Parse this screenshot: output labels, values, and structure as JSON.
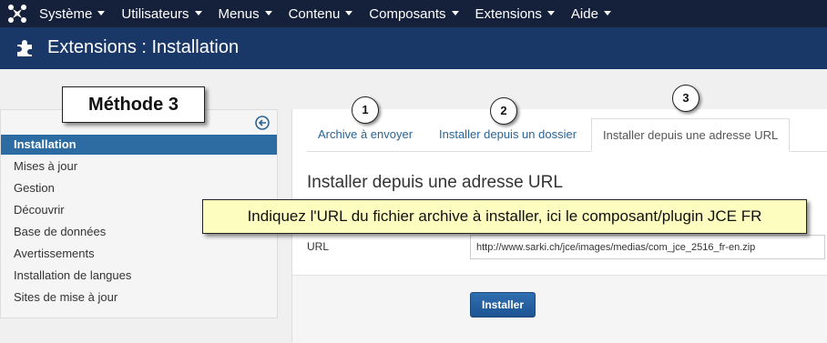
{
  "topbar": {
    "menu": [
      {
        "label": "Système"
      },
      {
        "label": "Utilisateurs"
      },
      {
        "label": "Menus"
      },
      {
        "label": "Contenu"
      },
      {
        "label": "Composants"
      },
      {
        "label": "Extensions"
      },
      {
        "label": "Aide"
      }
    ]
  },
  "header": {
    "title": "Extensions : Installation",
    "icon": "puzzle-icon"
  },
  "sidebar": {
    "items": [
      {
        "label": "Installation",
        "active": true
      },
      {
        "label": "Mises à jour"
      },
      {
        "label": "Gestion"
      },
      {
        "label": "Découvrir"
      },
      {
        "label": "Base de données"
      },
      {
        "label": "Avertissements"
      },
      {
        "label": "Installation de langues"
      },
      {
        "label": "Sites de mise à jour"
      }
    ]
  },
  "tabs": [
    {
      "label": "Archive à envoyer"
    },
    {
      "label": "Installer depuis un dossier"
    },
    {
      "label": "Installer depuis une adresse URL",
      "active": true
    }
  ],
  "main": {
    "section_title": "Installer depuis une adresse URL",
    "url_label": "URL",
    "url_value": "http://www.sarki.ch/jce/images/medias/com_jce_2516_fr-en.zip",
    "install_label": "Installer"
  },
  "annotations": {
    "method": "Méthode 3",
    "steps": [
      "1",
      "2",
      "3"
    ],
    "tooltip": "Indiquez l'URL du fichier archive à installer, ici le composant/plugin JCE FR"
  },
  "colors": {
    "topbar_bg": "#15213a",
    "header_bg": "#1a3867",
    "active_item": "#2d6ca2",
    "link": "#2a6496",
    "tooltip_bg": "#fdfdbf"
  }
}
